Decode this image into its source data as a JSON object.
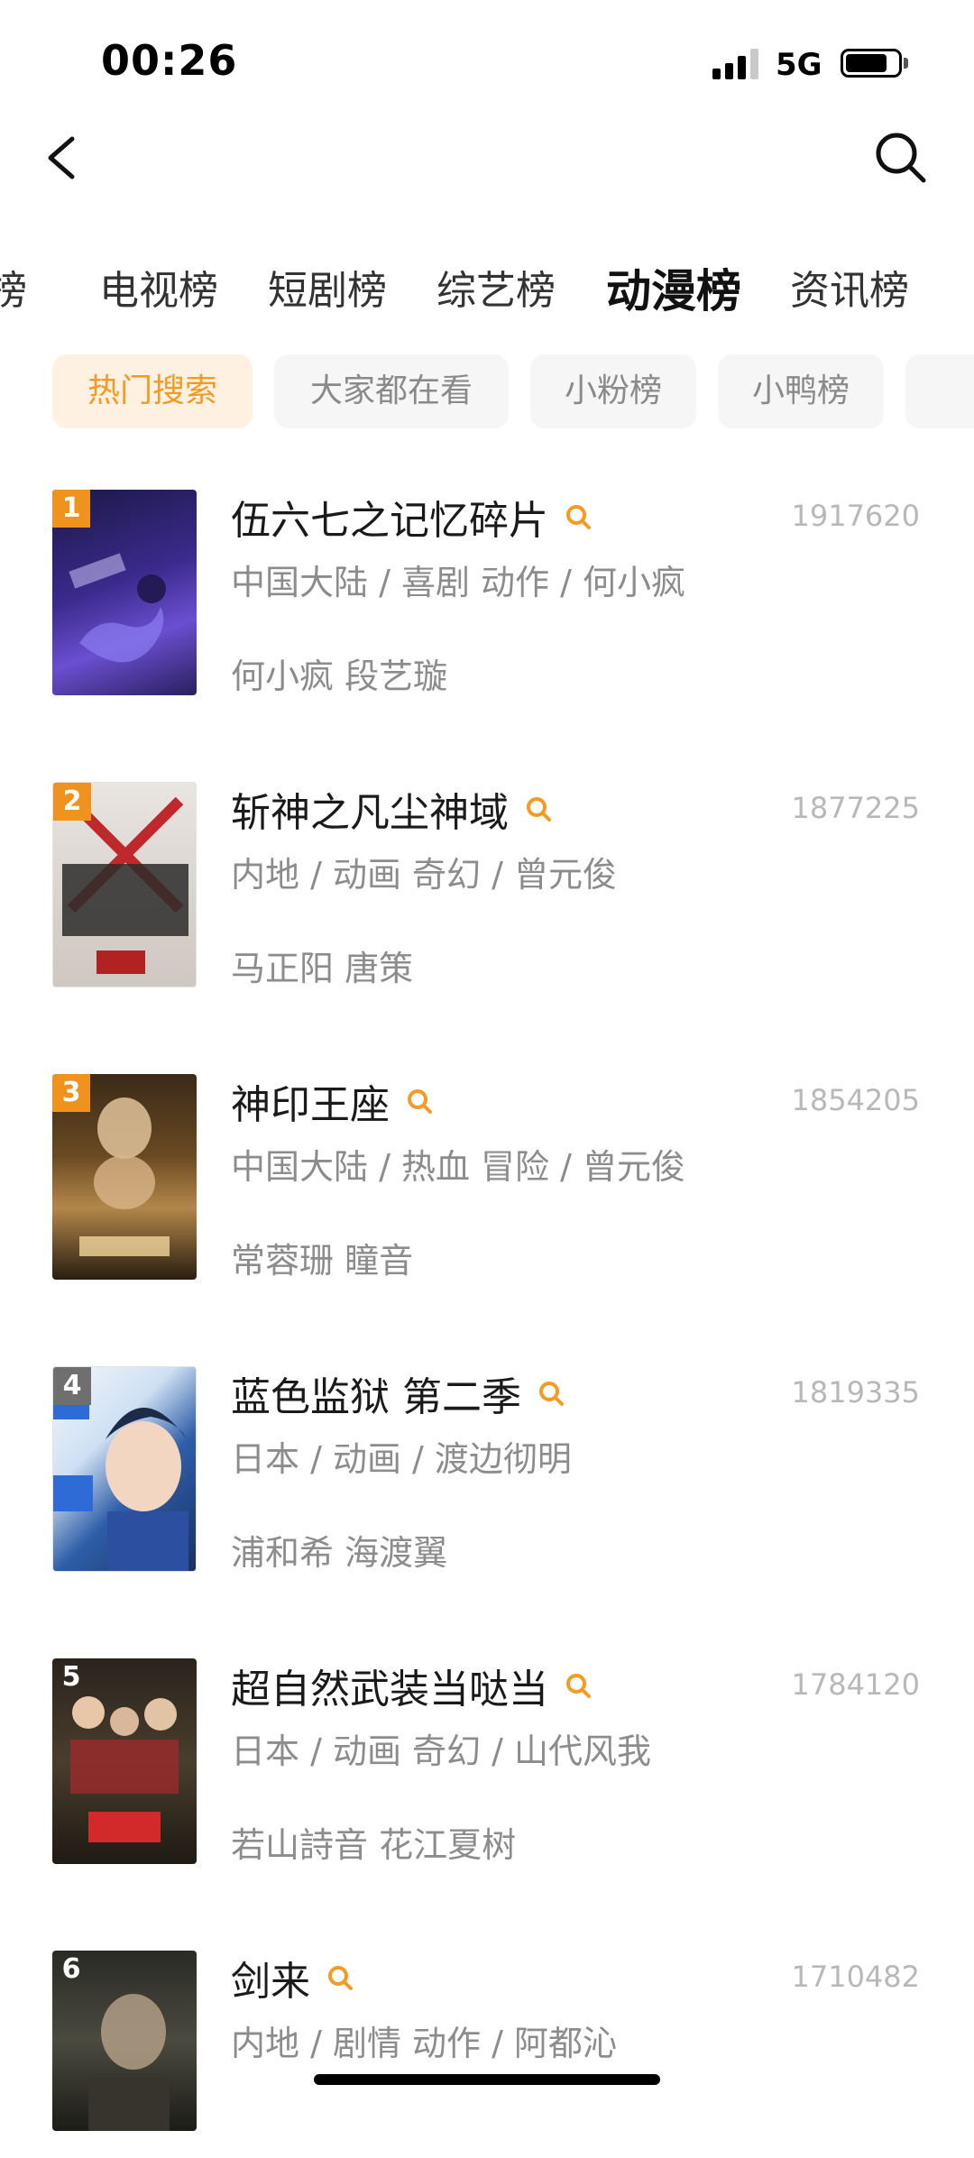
{
  "status_bar": {
    "time": "00:26",
    "network": "5G",
    "battery_level": 0.8
  },
  "nav": {
    "back_icon": "chevron-left-icon",
    "search_icon": "search-icon"
  },
  "tabs": [
    {
      "label": "榜"
    },
    {
      "label": "电视榜"
    },
    {
      "label": "短剧榜"
    },
    {
      "label": "综艺榜"
    },
    {
      "label": "动漫榜",
      "active": true
    },
    {
      "label": "资讯榜"
    }
  ],
  "chips": [
    {
      "label": "热门搜索",
      "active": true
    },
    {
      "label": "大家都在看"
    },
    {
      "label": "小粉榜"
    },
    {
      "label": "小鸭榜"
    },
    {
      "label": ""
    }
  ],
  "colors": {
    "accent": "#f59a23",
    "rank_top": "#f0921e",
    "rank_other": "#6f6f6f"
  },
  "items": [
    {
      "rank": "1",
      "title": "伍六七之记忆碎片",
      "score": "1917620",
      "meta": "中国大陆 / 喜剧 动作 / 何小疯",
      "cast": "何小疯 段艺璇"
    },
    {
      "rank": "2",
      "title": "斩神之凡尘神域",
      "score": "1877225",
      "meta": "内地 / 动画 奇幻 / 曾元俊",
      "cast": "马正阳 唐策"
    },
    {
      "rank": "3",
      "title": "神印王座",
      "score": "1854205",
      "meta": "中国大陆 / 热血 冒险 / 曾元俊",
      "cast": "常蓉珊 瞳音"
    },
    {
      "rank": "4",
      "title": "蓝色监狱 第二季",
      "score": "1819335",
      "meta": "日本 / 动画 / 渡边彻明",
      "cast": "浦和希 海渡翼"
    },
    {
      "rank": "5",
      "title": "超自然武装当哒当",
      "score": "1784120",
      "meta": "日本 / 动画 奇幻 / 山代风我",
      "cast": "若山詩音 花江夏树"
    },
    {
      "rank": "6",
      "title": "剑来",
      "score": "1710482",
      "meta": "内地 / 剧情 动作 / 阿都沁",
      "cast": ""
    }
  ]
}
